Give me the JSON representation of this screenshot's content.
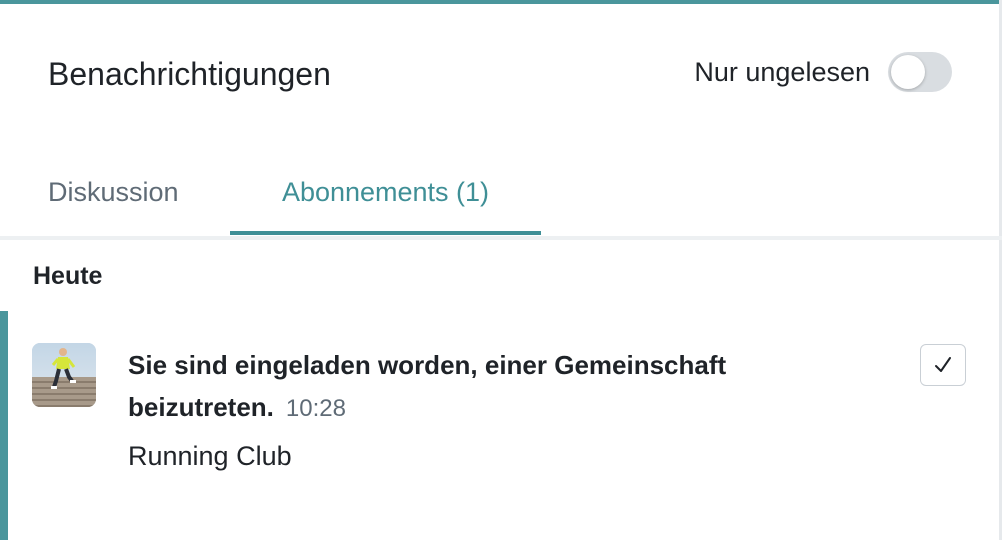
{
  "header": {
    "title": "Benachrichtigungen",
    "filter_label": "Nur ungelesen",
    "filter_on": false
  },
  "tabs": [
    {
      "label": "Diskussion",
      "active": false
    },
    {
      "label": "Abonnements (1)",
      "active": true
    }
  ],
  "groups": [
    {
      "heading": "Heute",
      "items": [
        {
          "title": "Sie sind eingeladen worden, einer Gemeinschaft beizutreten.",
          "time": "10:28",
          "subtitle": "Running Club",
          "avatar": "running-club-image",
          "action_icon": "checkmark-icon",
          "unread": true
        }
      ]
    }
  ],
  "colors": {
    "accent": "#3f8f96",
    "toggle_off": "#d9dde1",
    "muted_text": "#5f6b76"
  }
}
